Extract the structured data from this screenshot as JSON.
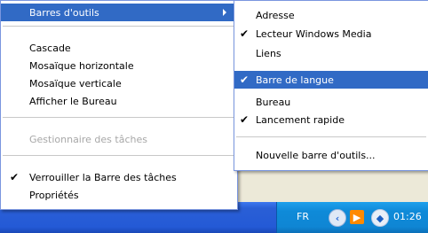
{
  "main_menu": {
    "items": [
      {
        "label": "Barres d'outils",
        "highlighted": true,
        "has_submenu": true
      },
      {
        "label": "Cascade"
      },
      {
        "label": "Mosaïque horizontale"
      },
      {
        "label": "Mosaïque verticale"
      },
      {
        "label": "Afficher le Bureau"
      },
      {
        "label": "Gestionnaire des tâches",
        "disabled": true
      },
      {
        "label": "Verrouiller la Barre des tâches",
        "checked": true
      },
      {
        "label": "Propriétés"
      }
    ]
  },
  "sub_menu": {
    "items": [
      {
        "label": "Adresse"
      },
      {
        "label": "Lecteur Windows Media",
        "checked": true
      },
      {
        "label": "Liens"
      },
      {
        "label": "Barre de langue",
        "checked": true,
        "highlighted": true
      },
      {
        "label": "Bureau"
      },
      {
        "label": "Lancement rapide",
        "checked": true
      },
      {
        "label": "Nouvelle barre d'outils..."
      }
    ]
  },
  "taskbar": {
    "language": "FR",
    "clock": "01:26"
  },
  "icons": {
    "check": "checkmark-icon",
    "submenu": "chevron-right-icon",
    "tray": [
      "back-arrow-icon",
      "media-flag-icon",
      "shield-icon"
    ]
  },
  "colors": {
    "highlight": "#316ac5",
    "taskbar": "#245ad6",
    "tray": "#0f86d4"
  }
}
